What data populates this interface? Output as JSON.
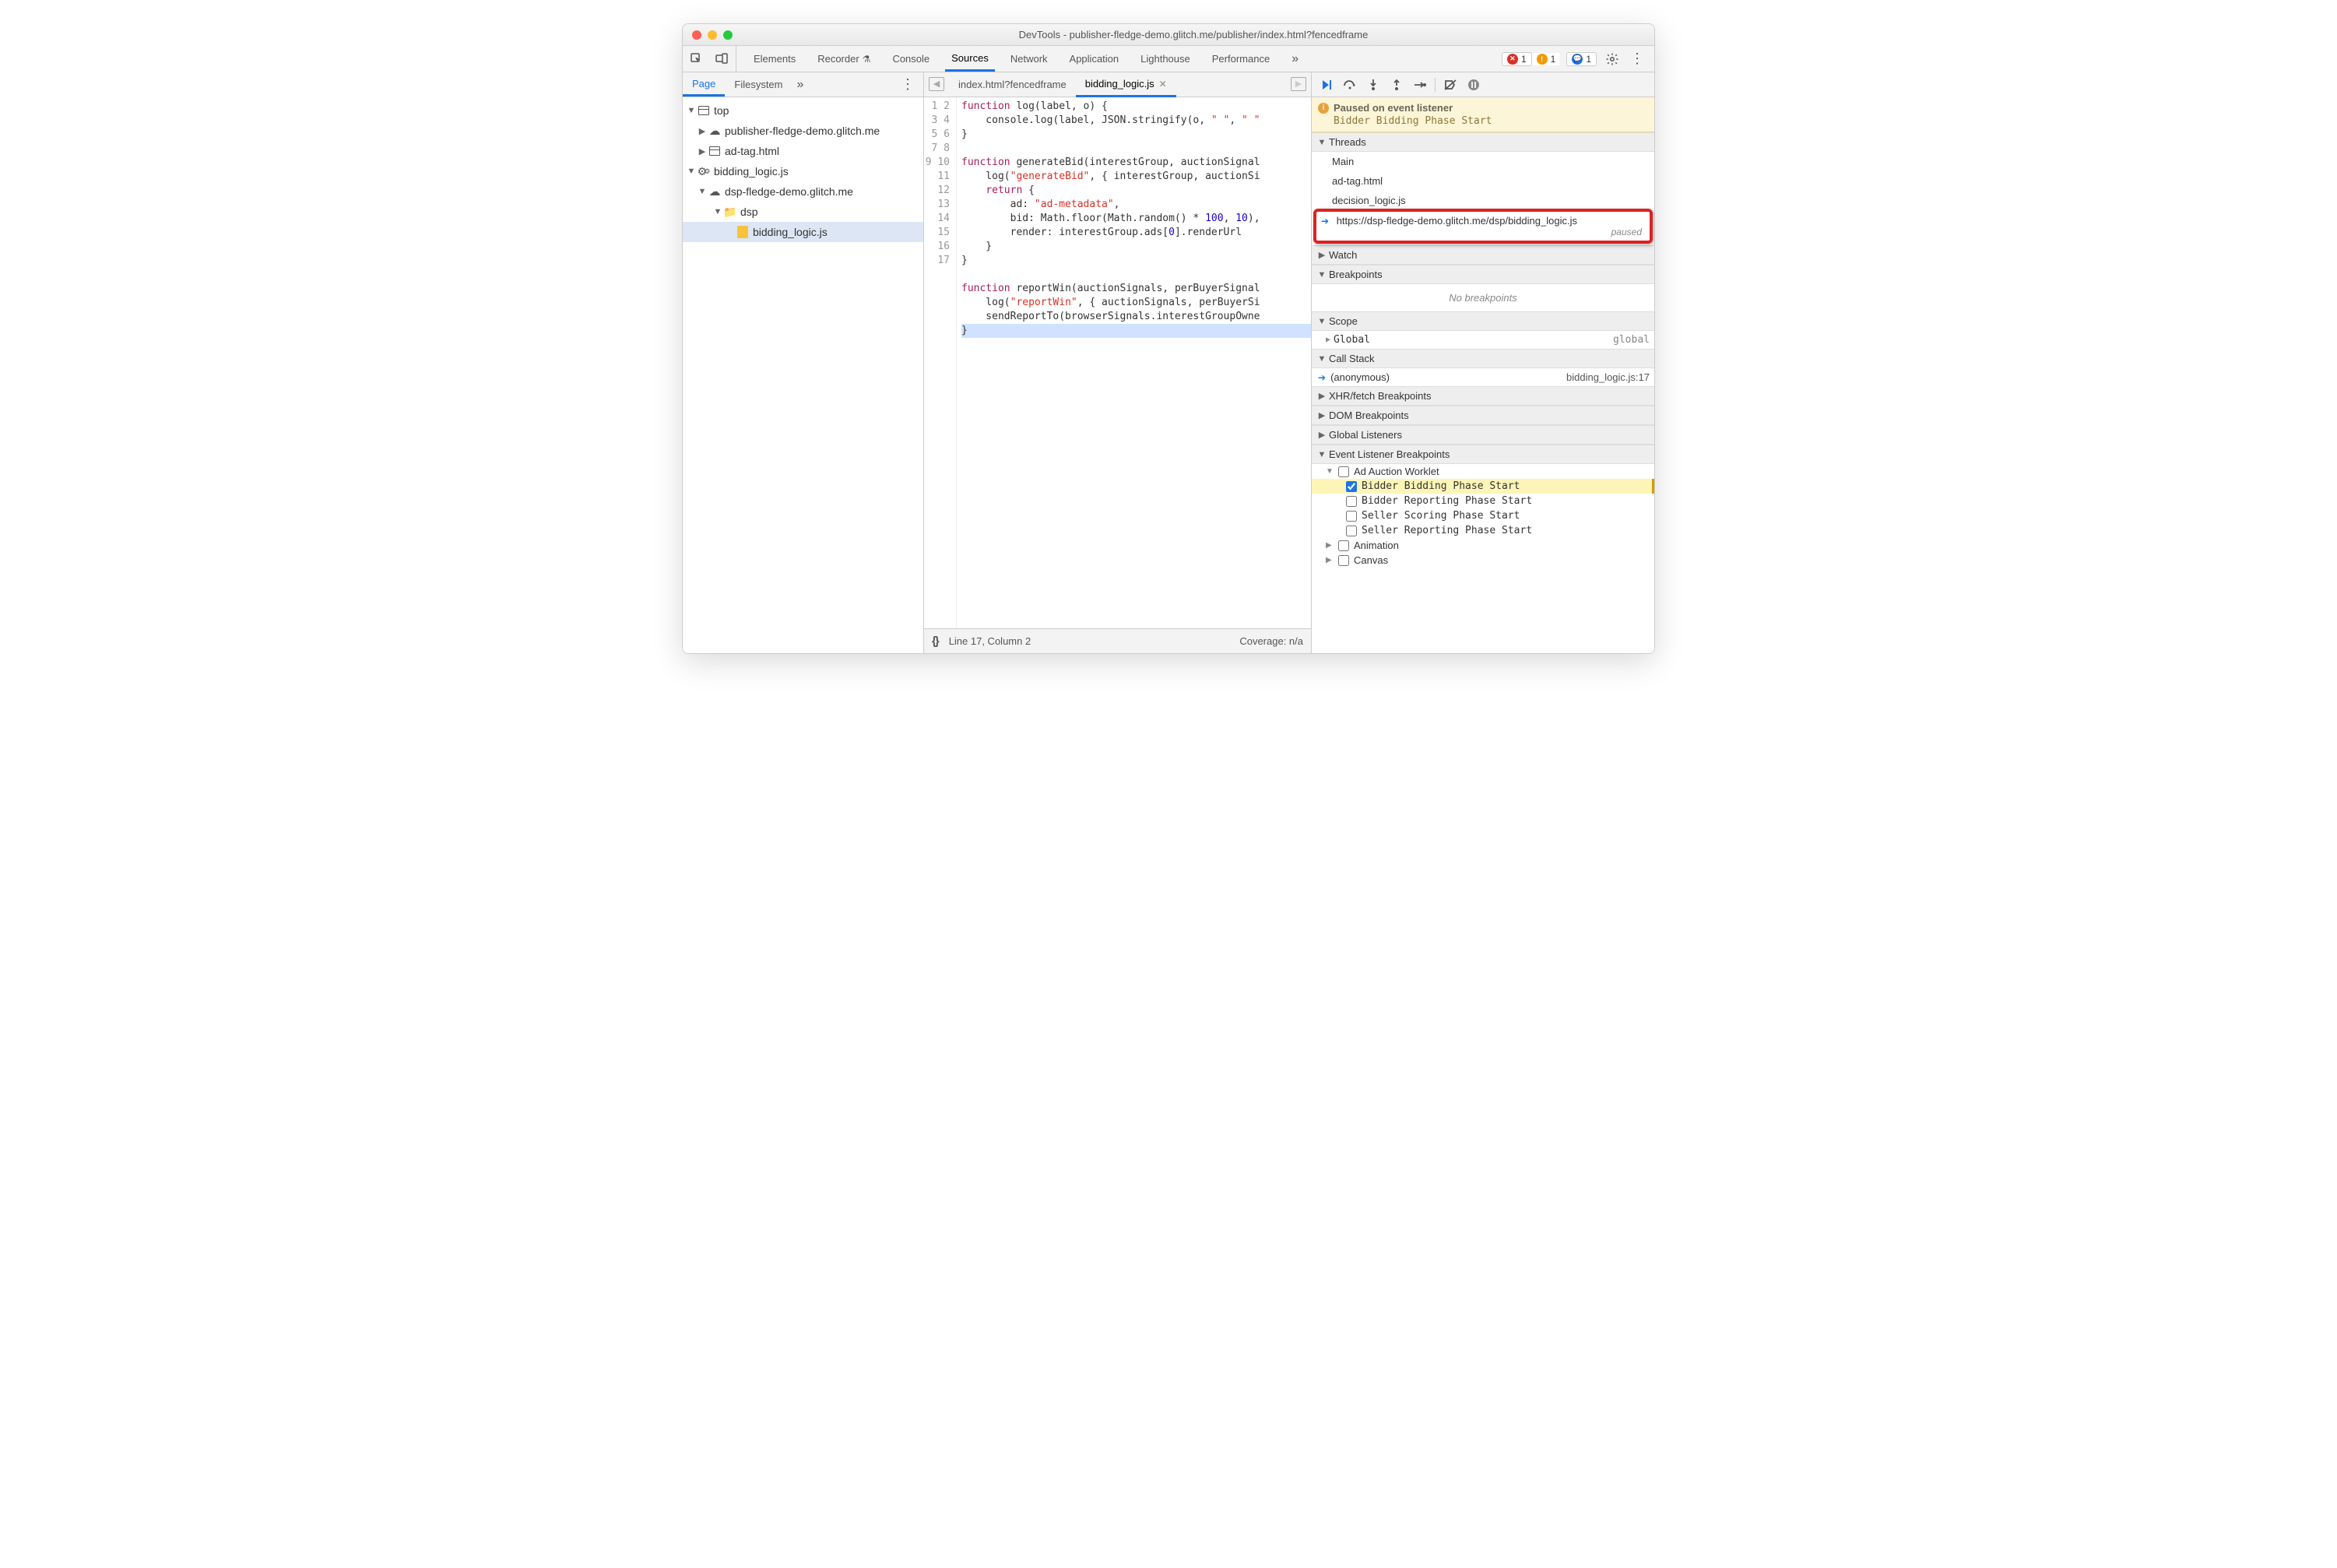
{
  "window": {
    "title": "DevTools - publisher-fledge-demo.glitch.me/publisher/index.html?fencedframe"
  },
  "panels": [
    "Elements",
    "Recorder",
    "Console",
    "Sources",
    "Network",
    "Application",
    "Lighthouse",
    "Performance"
  ],
  "panels_active": "Sources",
  "badges": {
    "errors": "1",
    "warnings": "1",
    "messages": "1"
  },
  "navigator": {
    "tabs": [
      "Page",
      "Filesystem"
    ],
    "active": "Page",
    "tree": {
      "top": "top",
      "pub_origin": "publisher-fledge-demo.glitch.me",
      "ad_tag": "ad-tag.html",
      "worklet": "bidding_logic.js",
      "dsp_origin": "dsp-fledge-demo.glitch.me",
      "dsp_folder": "dsp",
      "dsp_file": "bidding_logic.js"
    }
  },
  "editor": {
    "tabs": [
      {
        "name": "index.html?fencedframe",
        "active": false
      },
      {
        "name": "bidding_logic.js",
        "active": true
      }
    ],
    "status": {
      "pos": "Line 17, Column 2",
      "coverage": "Coverage: n/a"
    },
    "code_lines": 17
  },
  "debugger": {
    "paused": {
      "title": "Paused on event listener",
      "detail": "Bidder Bidding Phase Start"
    },
    "sections": {
      "threads": "Threads",
      "watch": "Watch",
      "breakpoints": "Breakpoints",
      "scope": "Scope",
      "callstack": "Call Stack",
      "xhr": "XHR/fetch Breakpoints",
      "dom": "DOM Breakpoints",
      "global_listeners": "Global Listeners",
      "event_listener": "Event Listener Breakpoints"
    },
    "threads": [
      "Main",
      "ad-tag.html",
      "decision_logic.js"
    ],
    "thread_current": {
      "url": "https://dsp-fledge-demo.glitch.me/dsp/bidding_logic.js",
      "state": "paused"
    },
    "no_breakpoints": "No breakpoints",
    "scope_global": {
      "name": "Global",
      "value": "global"
    },
    "stack": {
      "fn": "(anonymous)",
      "loc": "bidding_logic.js:17"
    },
    "elbp_category": "Ad Auction Worklet",
    "elbp_items": [
      {
        "label": "Bidder Bidding Phase Start",
        "checked": true
      },
      {
        "label": "Bidder Reporting Phase Start",
        "checked": false
      },
      {
        "label": "Seller Scoring Phase Start",
        "checked": false
      },
      {
        "label": "Seller Reporting Phase Start",
        "checked": false
      }
    ],
    "elbp_tail": [
      "Animation",
      "Canvas"
    ]
  }
}
